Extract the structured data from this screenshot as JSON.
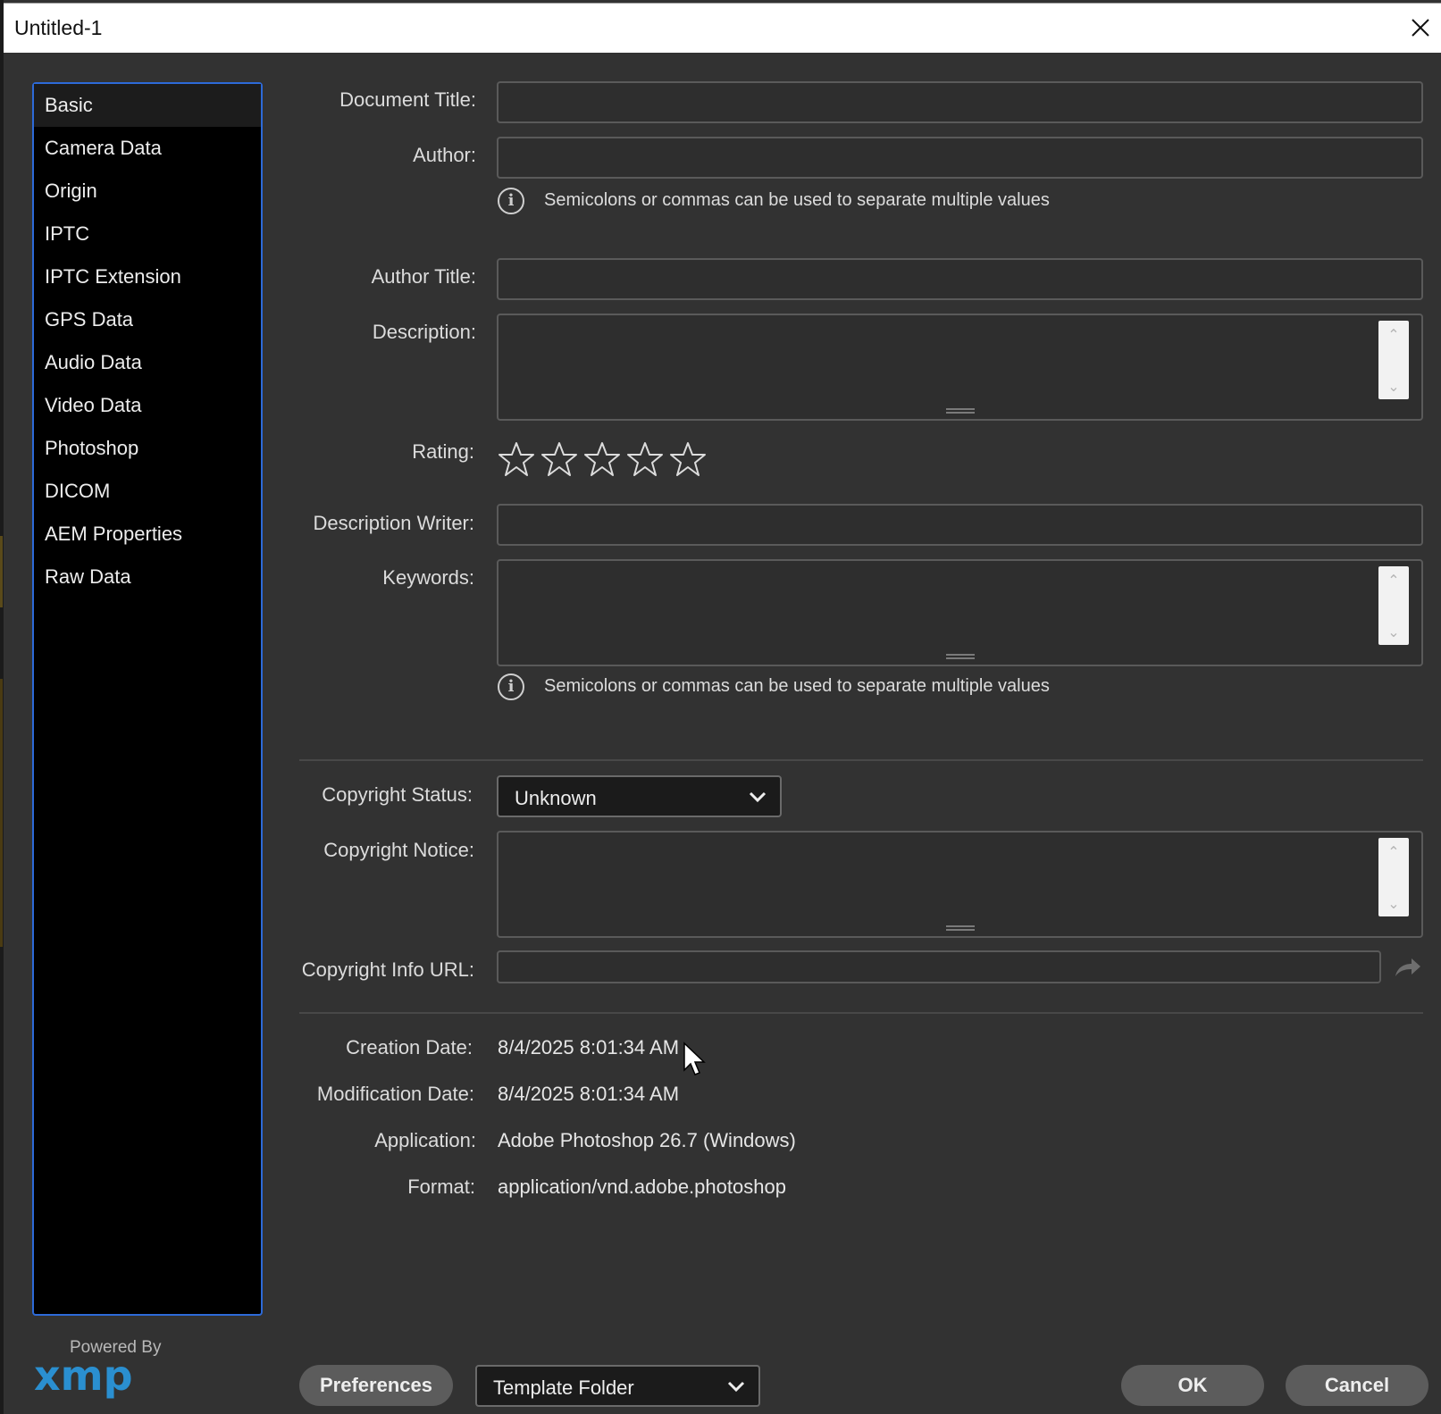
{
  "window": {
    "title": "Untitled-1"
  },
  "sidebar": {
    "items": [
      {
        "label": "Basic",
        "active": true
      },
      {
        "label": "Camera Data"
      },
      {
        "label": "Origin"
      },
      {
        "label": "IPTC"
      },
      {
        "label": "IPTC Extension"
      },
      {
        "label": "GPS Data"
      },
      {
        "label": "Audio Data"
      },
      {
        "label": "Video Data"
      },
      {
        "label": "Photoshop"
      },
      {
        "label": "DICOM"
      },
      {
        "label": "AEM Properties"
      },
      {
        "label": "Raw Data"
      }
    ]
  },
  "form": {
    "document_title": {
      "label": "Document Title:",
      "value": ""
    },
    "author": {
      "label": "Author:",
      "value": ""
    },
    "author_hint": "Semicolons or commas can be used to separate multiple values",
    "author_title": {
      "label": "Author Title:",
      "value": ""
    },
    "description": {
      "label": "Description:",
      "value": ""
    },
    "rating": {
      "label": "Rating:",
      "value": 0,
      "max": 5
    },
    "description_writer": {
      "label": "Description Writer:",
      "value": ""
    },
    "keywords": {
      "label": "Keywords:",
      "value": ""
    },
    "keywords_hint": "Semicolons or commas can be used to separate multiple values",
    "copyright_status": {
      "label": "Copyright Status:",
      "value": "Unknown"
    },
    "copyright_notice": {
      "label": "Copyright Notice:",
      "value": ""
    },
    "copyright_info_url": {
      "label": "Copyright Info URL:",
      "value": ""
    }
  },
  "info": {
    "creation_date": {
      "label": "Creation Date:",
      "value": "8/4/2025 8:01:34 AM"
    },
    "modification_date": {
      "label": "Modification Date:",
      "value": "8/4/2025 8:01:34 AM"
    },
    "application": {
      "label": "Application:",
      "value": "Adobe Photoshop 26.7 (Windows)"
    },
    "format": {
      "label": "Format:",
      "value": "application/vnd.adobe.photoshop"
    }
  },
  "footer": {
    "powered_by": "Powered By",
    "logo_text": "xmp",
    "preferences_label": "Preferences",
    "template_folder": "Template Folder",
    "ok_label": "OK",
    "cancel_label": "Cancel"
  },
  "icons": {
    "close": "close-icon",
    "info": "info-icon",
    "star": "star-outline-icon",
    "chevron": "chevron-down-icon",
    "share": "share-arrow-icon"
  },
  "colors": {
    "panel_bg": "#323232",
    "sidebar_bg": "#000000",
    "sidebar_border": "#2d6ad8",
    "button_bg": "#5c5c5c",
    "logo": "#2a8fd0"
  }
}
